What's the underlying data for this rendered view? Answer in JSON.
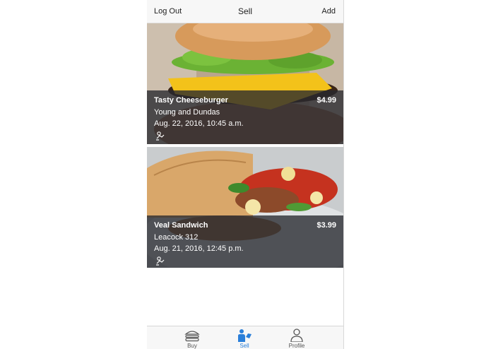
{
  "nav": {
    "left": "Log Out",
    "title": "Sell",
    "right": "Add"
  },
  "listings": [
    {
      "name": "Tasty Cheeseburger",
      "location": "Young and Dundas",
      "date": "Aug. 22, 2016, 10:45 a.m.",
      "price": "$4.99",
      "icon": "hand-offer-icon"
    },
    {
      "name": "Veal Sandwich",
      "location": "Leacock 312",
      "date": "Aug. 21, 2016, 12:45 p.m.",
      "price": "$3.99",
      "icon": "hand-offer-icon"
    }
  ],
  "tabs": [
    {
      "label": "Buy",
      "icon": "burger-icon",
      "active": false
    },
    {
      "label": "Sell",
      "icon": "seller-icon",
      "active": true
    },
    {
      "label": "Profile",
      "icon": "person-icon",
      "active": false
    }
  ],
  "colors": {
    "accent": "#2a7fd9",
    "overlay": "#26282e",
    "navbar": "#f7f7f7"
  }
}
